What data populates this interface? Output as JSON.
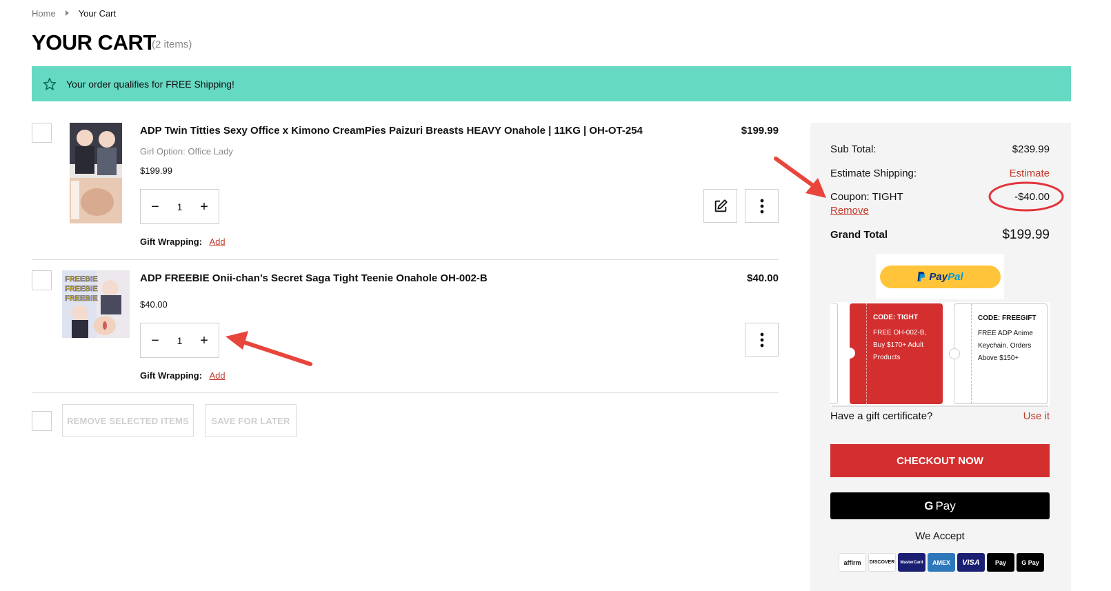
{
  "breadcrumb": {
    "home": "Home",
    "current": "Your Cart"
  },
  "page": {
    "title": "YOUR CART",
    "item_count": "(2 items)"
  },
  "banner": {
    "text": "Your order qualifies for FREE Shipping!",
    "icon": "star-icon",
    "color": "#66d9c3"
  },
  "items": [
    {
      "name": "ADP Twin Titties Sexy Office x Kimono CreamPies Paizuri Breasts HEAVY Onahole | 11KG | OH-OT-254",
      "option_label": "Girl Option:",
      "option_value": "Office Lady",
      "unit_price": "$199.99",
      "line_price": "$199.99",
      "quantity": "1",
      "gift_label": "Gift Wrapping:",
      "gift_action": "Add"
    },
    {
      "name": "ADP FREEBIE Onii-chan’s Secret Saga Tight Teenie Onahole OH-002-B",
      "unit_price": "$40.00",
      "line_price": "$40.00",
      "quantity": "1",
      "gift_label": "Gift Wrapping:",
      "gift_action": "Add",
      "thumb_text": [
        "FREEBIE",
        "FREEBIE",
        "FREEBIE"
      ]
    }
  ],
  "actions": {
    "remove_selected": "REMOVE SELECTED ITEMS",
    "save_later": "SAVE FOR LATER"
  },
  "summary": {
    "subtotal_label": "Sub Total:",
    "subtotal_value": "$239.99",
    "shipping_label": "Estimate Shipping:",
    "shipping_action": "Estimate",
    "coupon_label": "Coupon: TIGHT",
    "coupon_value": "-$40.00",
    "coupon_remove": "Remove",
    "grand_total_label": "Grand Total",
    "grand_total_value": "$199.99",
    "paypal": {
      "p1": "Pay",
      "p2": "Pal"
    },
    "coupons": [
      {
        "code": "CODE: TIGHT",
        "lines": [
          "FREE OH-002-B,",
          "Buy $170+ Adult",
          "Products"
        ]
      },
      {
        "code": "CODE: FREEGIFT",
        "lines": [
          "FREE ADP Anime",
          "Keychain. Orders",
          "Above $150+"
        ]
      }
    ],
    "gift_cert_label": "Have a gift certificate?",
    "gift_cert_action": "Use it",
    "checkout_label": "CHECKOUT NOW",
    "gpay_g": "G",
    "gpay_label": "Pay",
    "we_accept": "We Accept",
    "cards": [
      {
        "name": "affirm",
        "bg": "#ffffff",
        "fg": "#111111"
      },
      {
        "name": "DISCOVER",
        "bg": "#ffffff",
        "fg": "#111111"
      },
      {
        "name": "MasterCard",
        "bg": "#1a1f71",
        "fg": "#ffffff"
      },
      {
        "name": "AMEX",
        "bg": "#2e77bb",
        "fg": "#ffffff"
      },
      {
        "name": "VISA",
        "bg": "#1a1f71",
        "fg": "#ffffff"
      },
      {
        "name": "Pay",
        "bg": "#000000",
        "fg": "#ffffff"
      },
      {
        "name": "G Pay",
        "bg": "#000000",
        "fg": "#ffffff"
      }
    ]
  },
  "colors": {
    "accent_red": "#d32f2f",
    "link_red": "#c0392b",
    "banner_teal": "#66d9c3",
    "annotation_red": "#e8453c"
  }
}
